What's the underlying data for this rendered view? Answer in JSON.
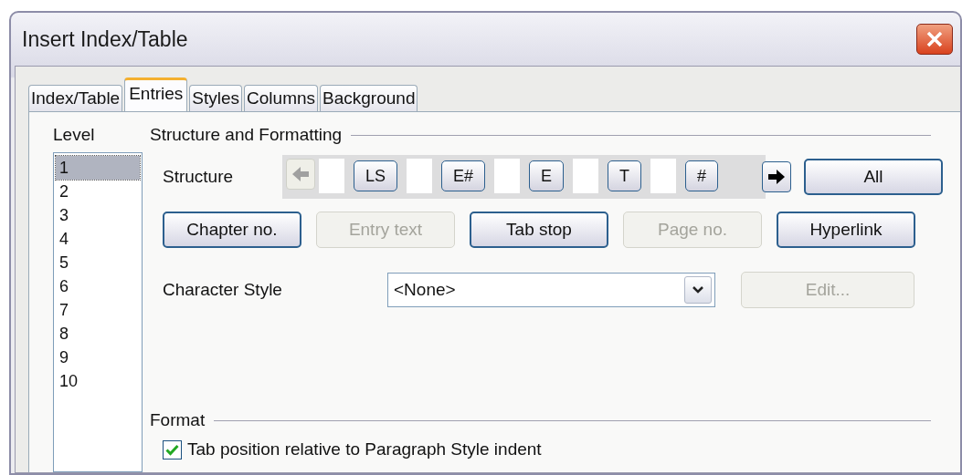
{
  "window": {
    "title": "Insert Index/Table"
  },
  "tabs": [
    {
      "label": "Index/Table",
      "selected": false
    },
    {
      "label": "Entries",
      "selected": true
    },
    {
      "label": "Styles",
      "selected": false
    },
    {
      "label": "Columns",
      "selected": false
    },
    {
      "label": "Background",
      "selected": false
    }
  ],
  "level": {
    "label": "Level",
    "items": [
      {
        "label": "1",
        "selected": true
      },
      {
        "label": "2",
        "selected": false
      },
      {
        "label": "3",
        "selected": false
      },
      {
        "label": "4",
        "selected": false
      },
      {
        "label": "5",
        "selected": false
      },
      {
        "label": "6",
        "selected": false
      },
      {
        "label": "7",
        "selected": false
      },
      {
        "label": "8",
        "selected": false
      },
      {
        "label": "9",
        "selected": false
      },
      {
        "label": "10",
        "selected": false
      }
    ]
  },
  "structure_group": {
    "title": "Structure and Formatting",
    "structure_label": "Structure",
    "scroll_left": {
      "disabled": true
    },
    "scroll_right": {
      "disabled": false
    },
    "structure": [
      {
        "kind": "field"
      },
      {
        "kind": "token",
        "label": "LS"
      },
      {
        "kind": "field"
      },
      {
        "kind": "token",
        "label": "E#"
      },
      {
        "kind": "field"
      },
      {
        "kind": "token",
        "label": "E"
      },
      {
        "kind": "field"
      },
      {
        "kind": "token",
        "label": "T"
      },
      {
        "kind": "field"
      },
      {
        "kind": "token",
        "label": "#"
      }
    ],
    "all_button": {
      "label": "All",
      "disabled": false
    },
    "buttons": [
      {
        "label": "Chapter no.",
        "disabled": false
      },
      {
        "label": "Entry text",
        "disabled": true
      },
      {
        "label": "Tab stop",
        "disabled": false
      },
      {
        "label": "Page no.",
        "disabled": true
      },
      {
        "label": "Hyperlink",
        "disabled": false
      }
    ],
    "character_style": {
      "label": "Character Style",
      "value": "<None>"
    },
    "edit_button": {
      "label": "Edit...",
      "disabled": true
    }
  },
  "format_group": {
    "title": "Format",
    "checkbox": {
      "label": "Tab position relative to Paragraph Style indent",
      "checked": true
    }
  }
}
